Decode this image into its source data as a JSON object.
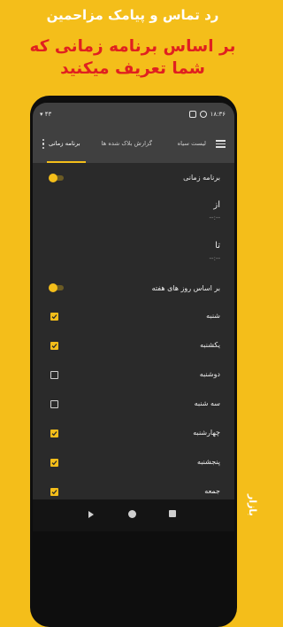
{
  "promo": {
    "line1": "رد تماس و پیامک مزاحمین",
    "line2": "بر اساس برنامه زمانی که",
    "line3": "شما تعریف میکنید"
  },
  "status_bar": {
    "time": "۱۸:۳۶",
    "network": "۴۳"
  },
  "app_bar": {
    "tabs": [
      {
        "label": "لیست سیاه"
      },
      {
        "label": "گزارش بلاک شده ها"
      },
      {
        "label": "برنامه زمانی"
      }
    ]
  },
  "schedule": {
    "title": "برنامه زمانی",
    "enabled": true,
    "from_label": "از",
    "from_value": "--:--",
    "to_label": "تا",
    "to_value": "--:--",
    "by_weekday_label": "بر اساس روز های هفته",
    "by_weekday_enabled": true,
    "days": [
      {
        "label": "شنبه",
        "checked": true
      },
      {
        "label": "یکشنبه",
        "checked": true
      },
      {
        "label": "دوشنبه",
        "checked": false
      },
      {
        "label": "سه شنبه",
        "checked": false
      },
      {
        "label": "چهارشنبه",
        "checked": true
      },
      {
        "label": "پنجشنبه",
        "checked": true
      },
      {
        "label": "جمعه",
        "checked": true
      }
    ]
  },
  "colors": {
    "accent": "#F4BE1A",
    "title_red": "#E02020",
    "dark_bg": "#2A2A2A"
  },
  "brand": "بازار"
}
